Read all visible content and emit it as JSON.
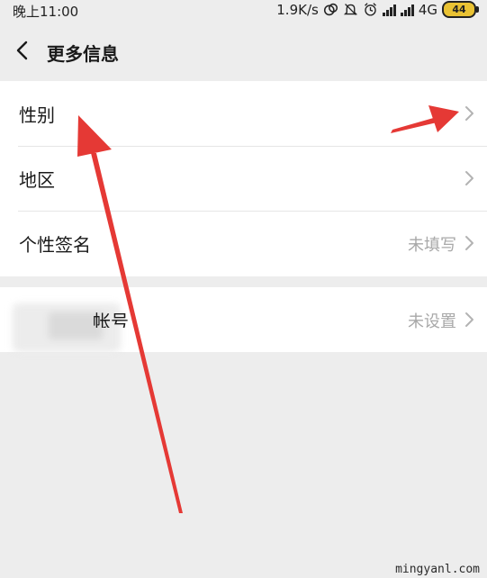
{
  "status_bar": {
    "time": "晚上11:00",
    "net_speed": "1.9K/s",
    "network": "4G",
    "battery_level": "44",
    "icons": [
      "data-saver-icon",
      "mute-icon",
      "alarm-icon",
      "signal-icon",
      "signal-icon"
    ]
  },
  "nav": {
    "back_icon": "chevron-left-icon",
    "title": "更多信息"
  },
  "group1": [
    {
      "label": "性别",
      "value": ""
    },
    {
      "label": "地区",
      "value": ""
    },
    {
      "label": "个性签名",
      "value": "未填写"
    }
  ],
  "group2": {
    "label_visible": "帐号",
    "value": "未设置"
  },
  "annotations": {
    "arrow_color": "#e53935",
    "arrows": [
      "pointer-arrow-up",
      "pointer-arrow-right"
    ]
  },
  "watermark": "mingyanl.com",
  "colors": {
    "background": "#ededed",
    "card": "#ffffff",
    "secondary_text": "#a8a8a8",
    "chevron": "#b3b3b3"
  }
}
